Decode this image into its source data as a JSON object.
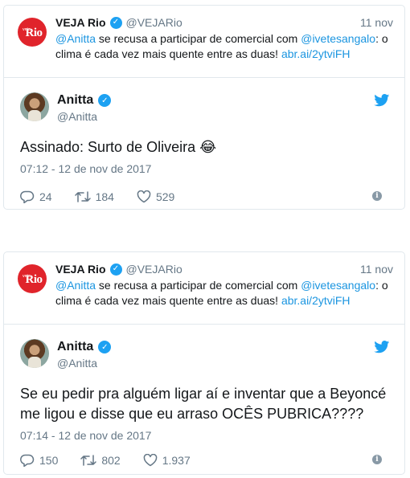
{
  "tweets": [
    {
      "quoted": {
        "name": "VEJA Rio",
        "handle": "@VEJARio",
        "date": "11 nov",
        "mention_1": "@Anitta",
        "text_1": " se recusa a participar de comercial com ",
        "mention_2": "@ivetesangalo",
        "text_2": ": o clima é cada vez mais quente entre as duas! ",
        "link": "abr.ai/2ytviFH",
        "avatar_text": "Rio"
      },
      "author": {
        "name": "Anitta",
        "handle": "@Anitta"
      },
      "text": "Assinado: Surto de Oliveira",
      "emoji": "😂",
      "timestamp": "07:12 - 12 de nov de 2017",
      "replies": "24",
      "retweets": "184",
      "likes": "529"
    },
    {
      "quoted": {
        "name": "VEJA Rio",
        "handle": "@VEJARio",
        "date": "11 nov",
        "mention_1": "@Anitta",
        "text_1": " se recusa a participar de comercial com ",
        "mention_2": "@ivetesangalo",
        "text_2": ": o clima é cada vez mais quente entre as duas! ",
        "link": "abr.ai/2ytviFH",
        "avatar_text": "Rio"
      },
      "author": {
        "name": "Anitta",
        "handle": "@Anitta"
      },
      "text": "Se eu pedir pra alguém ligar aí e inventar que a Beyoncé me ligou e disse que eu arraso OCÊS PUBRICA????",
      "timestamp": "07:14 - 12 de nov de 2017",
      "replies": "150",
      "retweets": "802",
      "likes": "1.937"
    }
  ],
  "colors": {
    "accent": "#1da1f2",
    "link": "#1b95e0",
    "muted": "#657786",
    "veja_red": "#e0242b"
  },
  "icons": [
    "verified-icon",
    "twitter-bird-icon",
    "reply-icon",
    "retweet-icon",
    "like-icon",
    "info-icon"
  ]
}
